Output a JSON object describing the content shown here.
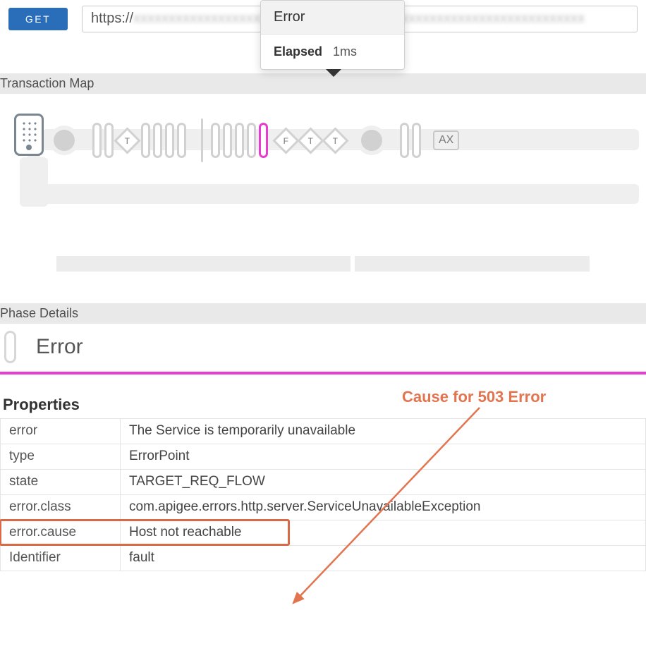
{
  "topbar": {
    "method": "GET",
    "url_prefix": "https://"
  },
  "tooltip": {
    "title": "Error",
    "elapsed_label": "Elapsed",
    "elapsed_value": "1ms"
  },
  "sections": {
    "transaction_map": "Transaction Map",
    "phase_details": "Phase Details"
  },
  "transaction_map": {
    "diamonds": [
      "T",
      "F",
      "T",
      "T"
    ],
    "ax_label": "AX"
  },
  "phase": {
    "title": "Error"
  },
  "annotation": {
    "text": "Cause for 503 Error"
  },
  "properties": {
    "heading": "Properties",
    "rows": [
      {
        "key": "error",
        "value": "The Service is temporarily unavailable"
      },
      {
        "key": "type",
        "value": "ErrorPoint"
      },
      {
        "key": "state",
        "value": "TARGET_REQ_FLOW"
      },
      {
        "key": "error.class",
        "value": "com.apigee.errors.http.server.ServiceUnavailableException"
      },
      {
        "key": "error.cause",
        "value": "Host not reachable",
        "highlight": true
      },
      {
        "key": "Identifier",
        "value": "fault"
      }
    ]
  }
}
